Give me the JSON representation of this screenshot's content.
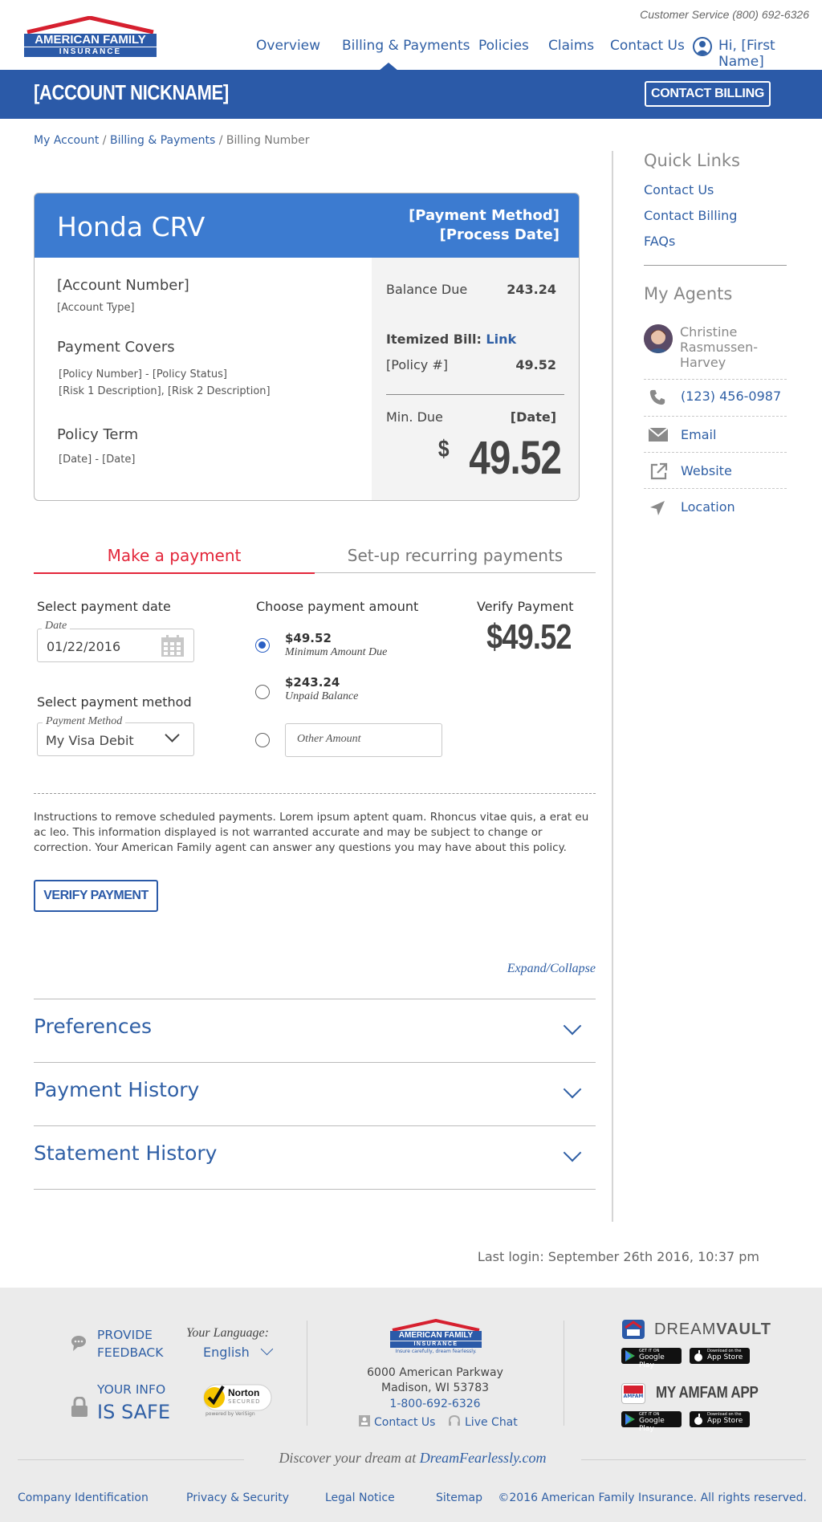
{
  "header": {
    "customer_service": "Customer Service (800) 692-6326",
    "logo_line1": "AMERICAN FAMILY",
    "logo_line2": "INSURANCE",
    "nav": [
      "Overview",
      "Billing & Payments",
      "Policies",
      "Claims",
      "Contact Us"
    ],
    "active_nav": "Billing & Payments",
    "user_greeting": "Hi, [First Name]",
    "account_nickname": "[ACCOUNT NICKNAME]",
    "contact_billing": "CONTACT BILLING"
  },
  "breadcrumb": {
    "items": [
      "My Account",
      "Billing & Payments"
    ],
    "current": "Billing Number",
    "sep": "/"
  },
  "bill_card": {
    "title": "Honda CRV",
    "payment_method": "[Payment Method]",
    "process_date": "[Process Date]",
    "account_number": "[Account Number]",
    "account_type": "[Account Type]",
    "payment_covers_label": "Payment Covers",
    "policy_line": "[Policy Number] - [Policy Status]",
    "risk_line": "[Risk 1 Description], [Risk 2 Description]",
    "policy_term_label": "Policy Term",
    "policy_term": "[Date] - [Date]",
    "balance_due_label": "Balance Due",
    "balance_due": "243.24",
    "itemized_label": "Itemized Bill:",
    "itemized_link": "Link",
    "policy_ref": "[Policy #]",
    "policy_amount": "49.52",
    "min_due_label": "Min. Due",
    "min_due_date": "[Date]",
    "min_due_currency": "$",
    "min_due_amount": "49.52"
  },
  "tabs": {
    "make_payment": "Make a payment",
    "recurring": "Set-up recurring payments"
  },
  "payment_form": {
    "date_heading": "Select payment date",
    "date_caption": "Date",
    "date_value": "01/22/2016",
    "method_heading": "Select payment method",
    "method_caption": "Payment Method",
    "method_value": "My Visa Debit",
    "amount_heading": "Choose payment amount",
    "options": [
      {
        "amount": "$49.52",
        "desc": "Minimum Amount Due",
        "selected": true
      },
      {
        "amount": "$243.24",
        "desc": "Unpaid Balance",
        "selected": false
      }
    ],
    "other_placeholder": "Other Amount",
    "verify_heading": "Verify Payment",
    "verify_amount": "$49.52",
    "instructions": "Instructions to remove scheduled payments. Lorem ipsum aptent quam. Rhoncus vitae quis, a erat eu ac leo. This information displayed is not warranted accurate and may be subject to change or correction. Your American Family agent can answer any questions you may have about this policy.",
    "verify_button": "VERIFY PAYMENT"
  },
  "accordion": {
    "expand_collapse": "Expand/Collapse",
    "sections": [
      "Preferences",
      "Payment History",
      "Statement History"
    ]
  },
  "sidebar": {
    "quick_links_title": "Quick Links",
    "quick_links": [
      "Contact Us",
      "Contact Billing",
      "FAQs"
    ],
    "agents_title": "My Agents",
    "agent_name_1": "Christine",
    "agent_name_2": "Rasmussen-",
    "agent_name_3": "Harvey",
    "phone": "(123) 456-0987",
    "email": "Email",
    "website": "Website",
    "location": "Location"
  },
  "last_login": "Last login: September 26th 2016, 10:37 pm",
  "footer": {
    "feedback_1": "PROVIDE",
    "feedback_2": "FEEDBACK",
    "language_label": "Your Language:",
    "language": "English",
    "your_info": "YOUR INFO",
    "is_safe": "IS SAFE",
    "norton_1": "Norton",
    "norton_2": "SECURED",
    "norton_3": "powered by VeriSign",
    "logo_line1": "AMERICAN FAMILY",
    "logo_line2": "INSURANCE",
    "tagline": "Insure carefully, dream fearlessly.",
    "address_1": "6000 American Parkway",
    "address_2": "Madison, WI 53783",
    "phone": "1-800-692-6326",
    "contact_us": "Contact Us",
    "live_chat": "Live Chat",
    "dreamvault_1": "DREAM",
    "dreamvault_2": "VAULT",
    "amfam_app": "MY AMFAM APP",
    "google_play_top": "GET IT ON",
    "google_play": "Google Play",
    "app_store_top": "Download on the",
    "app_store": "App Store",
    "amfam_icon": "AMFAM",
    "discover_prefix": "Discover your dream at",
    "discover_link": "DreamFearlessly.com",
    "links": [
      "Company Identification",
      "Privacy & Security",
      "Legal Notice",
      "Sitemap"
    ],
    "copyright": "©2016 American Family Insurance. All rights reserved."
  },
  "colors": {
    "brand_blue": "#2b5aa8",
    "card_header": "#3c7bd0",
    "link": "#2f5fa5",
    "active_tab": "#e3263a",
    "logo_red": "#d6202f"
  },
  "icons": [
    "user-icon",
    "calendar-icon",
    "chevron-down-icon",
    "phone-icon",
    "email-icon",
    "external-link-icon",
    "location-icon",
    "feedback-icon",
    "lock-icon"
  ]
}
